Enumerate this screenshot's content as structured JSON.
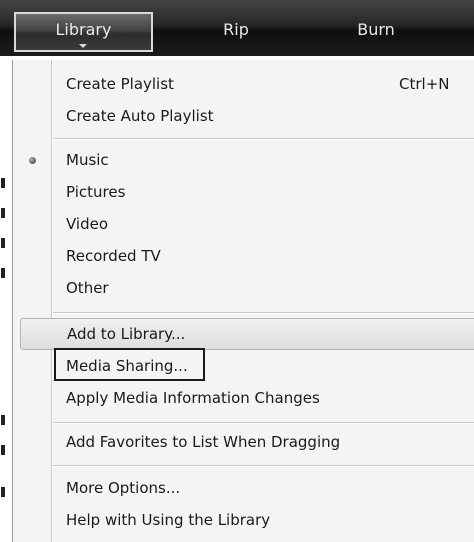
{
  "tabs": {
    "library": "Library",
    "rip": "Rip",
    "burn": "Burn"
  },
  "menu": {
    "create_playlist": "Create Playlist",
    "create_playlist_shortcut": "Ctrl+N",
    "create_auto_playlist": "Create Auto Playlist",
    "music": "Music",
    "pictures": "Pictures",
    "video": "Video",
    "recorded_tv": "Recorded TV",
    "other": "Other",
    "add_to_library": "Add to Library...",
    "media_sharing": "Media Sharing...",
    "apply_media_info": "Apply Media Information Changes",
    "add_favorites": "Add Favorites to List When Dragging",
    "more_options": "More Options...",
    "help_library": "Help with Using the Library"
  },
  "state": {
    "selected_library_type": "Music",
    "highlighted_item": "Add to Library...",
    "focused_item": "Media Sharing..."
  }
}
